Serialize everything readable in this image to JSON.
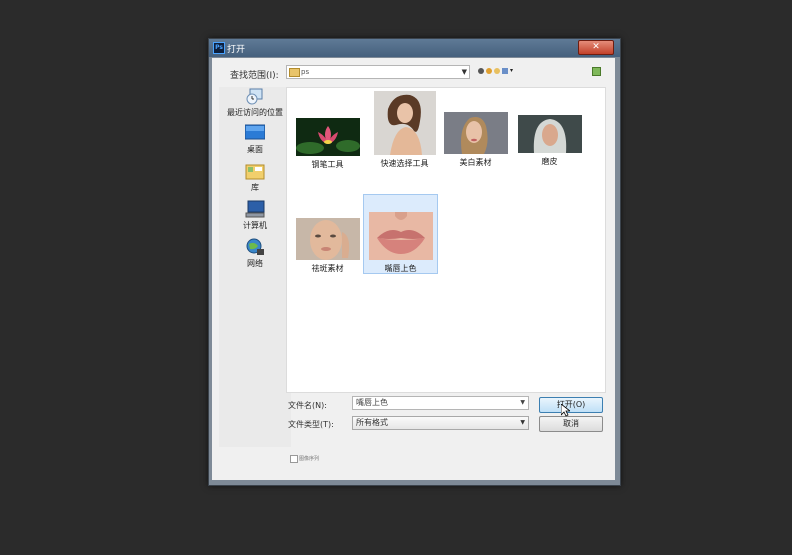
{
  "window": {
    "title": "打开",
    "app_icon": "Ps",
    "close_label": "✕"
  },
  "lookin": {
    "label": "查找范围(I):",
    "value": "ps"
  },
  "places": [
    {
      "label": "最近访问的位置",
      "icon": "recent-places-icon"
    },
    {
      "label": "桌面",
      "icon": "desktop-icon"
    },
    {
      "label": "库",
      "icon": "libraries-icon"
    },
    {
      "label": "计算机",
      "icon": "computer-icon"
    },
    {
      "label": "网络",
      "icon": "network-icon"
    }
  ],
  "files": [
    {
      "label": "钢笔工具"
    },
    {
      "label": "快速选择工具"
    },
    {
      "label": "美白素材"
    },
    {
      "label": "磨皮"
    },
    {
      "label": "祛斑素材"
    },
    {
      "label": "嘴唇上色",
      "selected": true
    }
  ],
  "filename": {
    "label": "文件名(N):",
    "value": "嘴唇上色"
  },
  "filetype": {
    "label": "文件类型(T):",
    "value": "所有格式"
  },
  "buttons": {
    "open": "打开(O)",
    "cancel": "取消"
  },
  "preview": {
    "label": "图像序列"
  }
}
